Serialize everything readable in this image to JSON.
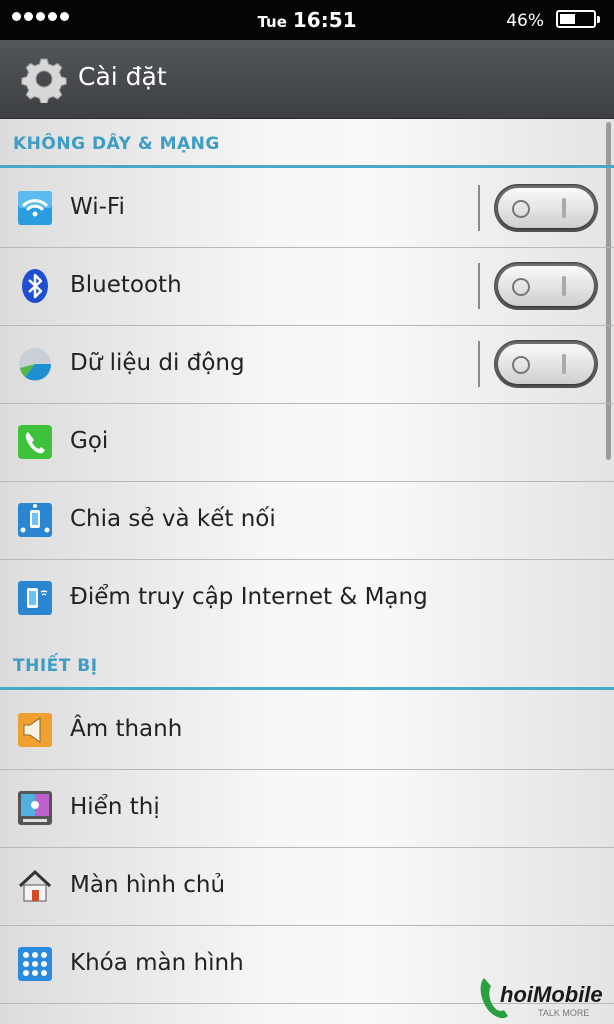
{
  "status_bar": {
    "day": "Tue",
    "time": "16:51",
    "battery_percent": "46%",
    "battery_level": 0.46,
    "signal_dots": 5
  },
  "action_bar": {
    "title": "Cài đặt",
    "icon": "gear-icon"
  },
  "sections": [
    {
      "title": "KHÔNG DÂY & MẠNG",
      "items": [
        {
          "label": "Wi-Fi",
          "icon": "wifi-icon",
          "toggle": "off"
        },
        {
          "label": "Bluetooth",
          "icon": "bluetooth-icon",
          "toggle": "off"
        },
        {
          "label": "Dữ liệu di động",
          "icon": "mobile-data-icon",
          "toggle": "off"
        },
        {
          "label": "Gọi",
          "icon": "phone-icon"
        },
        {
          "label": "Chia sẻ và kết nối",
          "icon": "share-connect-icon"
        },
        {
          "label": "Điểm truy cập Internet & Mạng",
          "icon": "hotspot-icon"
        }
      ]
    },
    {
      "title": "THIẾT BỊ",
      "items": [
        {
          "label": "Âm thanh",
          "icon": "speaker-icon"
        },
        {
          "label": "Hiển thị",
          "icon": "display-icon"
        },
        {
          "label": "Màn hình chủ",
          "icon": "home-icon"
        },
        {
          "label": "Khóa màn hình",
          "icon": "lock-screen-icon"
        }
      ]
    }
  ],
  "watermark": {
    "brand": "ChoiMobile",
    "tagline": "TALK MORE"
  },
  "colors": {
    "accent": "#4aa8c9",
    "section_text": "#3e9dc4",
    "action_bar": "#47494c"
  }
}
